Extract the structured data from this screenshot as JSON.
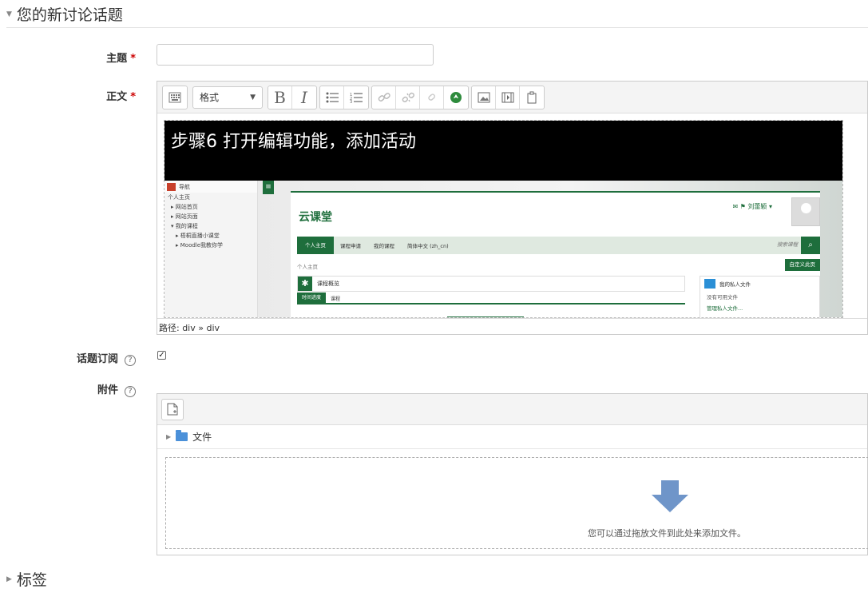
{
  "section_new": {
    "title": "您的新讨论话题"
  },
  "section_tags": {
    "title": "标签"
  },
  "subject": {
    "label": "主题",
    "required_mark": "*",
    "value": "",
    "placeholder": ""
  },
  "message": {
    "label": "正文",
    "required_mark": "*",
    "toolbar": {
      "format_label": "格式",
      "bold": "B",
      "italic": "I"
    },
    "content": {
      "banner": "步骤6 打开编辑功能，添加活动",
      "screenshot": {
        "nav_title": "导航",
        "nav_items": [
          "个人主页",
          "网站首页",
          "网站页面",
          "我的课程",
          "梧桐直播小课堂",
          "Moodle我教你学"
        ],
        "brand": "云课堂",
        "user_name": "刘蕾颖",
        "menu": [
          "个人主页",
          "课程申请",
          "我的课程",
          "简体中文 (zh_cn)"
        ],
        "search_placeholder": "搜索课程",
        "breadcrumb": "个人主页",
        "customize_button": "自定义此页",
        "block_title": "课程概览",
        "tabs": [
          "时间进度",
          "课程"
        ],
        "files_title": "我的私人文件",
        "files_empty": "没有可用文件",
        "files_manage": "管理私人文件..."
      }
    },
    "path": "路径: div » div"
  },
  "subscribe": {
    "label": "话题订阅",
    "checked": true,
    "help": "?"
  },
  "attachment": {
    "label": "附件",
    "help": "?",
    "folder": "文件",
    "drop_text": "您可以通过拖放文件到此处来添加文件。"
  },
  "colors": {
    "accent": "#1e6e3c",
    "required": "#cc0000",
    "folder": "#4a90d9",
    "arrow": "#6f95c9"
  }
}
